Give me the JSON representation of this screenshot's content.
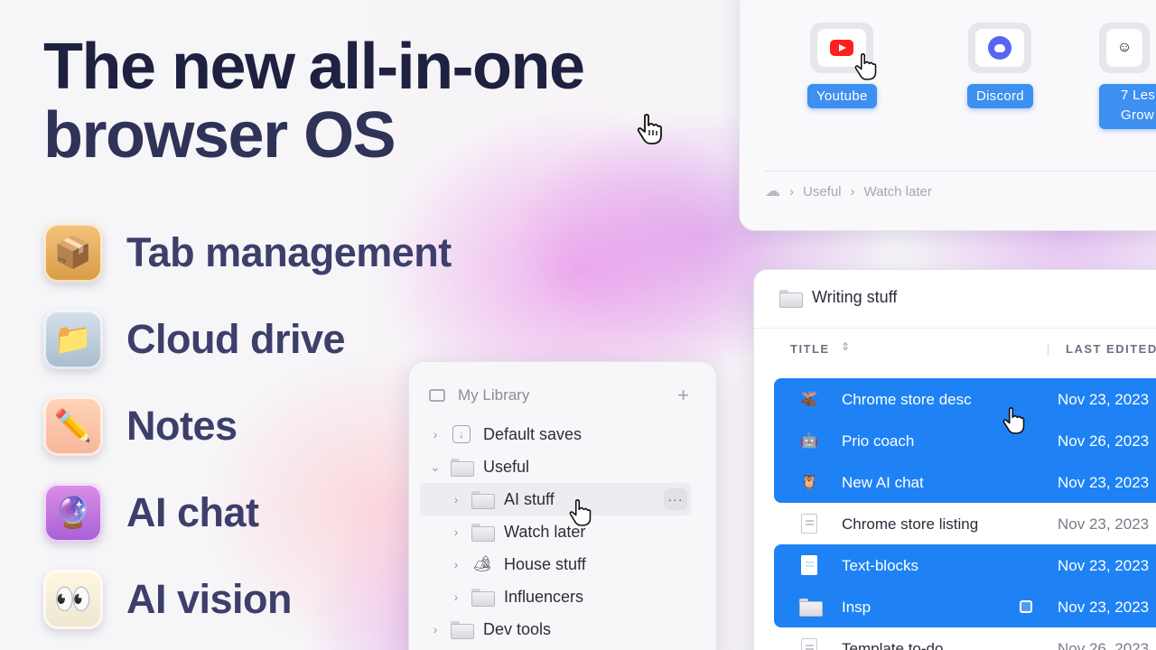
{
  "headline": {
    "line1_pre": "The new",
    "line1_highlight": "all-in-one",
    "line2": "browser OS"
  },
  "features": [
    {
      "label": "Tab management",
      "icon": "package-icon",
      "emoji": "📦"
    },
    {
      "label": "Cloud drive",
      "icon": "folder-icon",
      "emoji": "📁"
    },
    {
      "label": "Notes",
      "icon": "pencil-icon",
      "emoji": "✏️"
    },
    {
      "label": "AI chat",
      "icon": "crystal-ball-icon",
      "emoji": "🔮"
    },
    {
      "label": "AI vision",
      "icon": "eyes-icon",
      "emoji": "👀"
    }
  ],
  "app_panel": {
    "apps": [
      {
        "label": "Youtube",
        "icon": "youtube-icon"
      },
      {
        "label": "Discord",
        "icon": "discord-icon"
      },
      {
        "label": "7 Les\nGrow",
        "icon": "app-icon"
      }
    ],
    "breadcrumb": [
      "Useful",
      "Watch later"
    ]
  },
  "library": {
    "title": "My Library",
    "add_label": "+",
    "items": [
      {
        "label": "Default saves",
        "icon": "download-box-icon",
        "expanded": false
      },
      {
        "label": "Useful",
        "icon": "folder-icon",
        "expanded": true
      },
      {
        "label": "AI stuff",
        "icon": "folder-icon",
        "expanded": false,
        "selected": true
      },
      {
        "label": "Watch later",
        "icon": "folder-icon",
        "expanded": false
      },
      {
        "label": "House stuff",
        "icon": "camping-icon",
        "expanded": false
      },
      {
        "label": "Influencers",
        "icon": "folder-icon",
        "expanded": false
      },
      {
        "label": "Dev tools",
        "icon": "folder-icon",
        "expanded": false
      }
    ],
    "more_label": "···"
  },
  "writing": {
    "title": "Writing stuff",
    "col_title": "TITLE",
    "col_edited": "LAST EDITED",
    "rows": [
      {
        "title": "Chrome store desc",
        "date": "Nov 23, 2023",
        "icon": "moose-icon",
        "selected": true
      },
      {
        "title": "Prio coach",
        "date": "Nov 26, 2023",
        "icon": "robot-icon",
        "selected": true
      },
      {
        "title": "New AI chat",
        "date": "Nov 23, 2023",
        "icon": "owl-icon",
        "selected": true
      },
      {
        "title": "Chrome store listing",
        "date": "Nov 23, 2023",
        "icon": "document-icon",
        "selected": false
      },
      {
        "title": "Text-blocks",
        "date": "Nov 23, 2023",
        "icon": "document-icon",
        "selected": true
      },
      {
        "title": "Insp",
        "date": "Nov 23, 2023",
        "icon": "folder-icon",
        "selected": true
      },
      {
        "title": "Template to-do",
        "date": "Nov 26, 2023",
        "icon": "document-icon",
        "selected": false
      }
    ]
  },
  "colors": {
    "accent_blue": "#1e82f5",
    "headline": "#1f2140",
    "feature_text": "#3d3f6b"
  }
}
